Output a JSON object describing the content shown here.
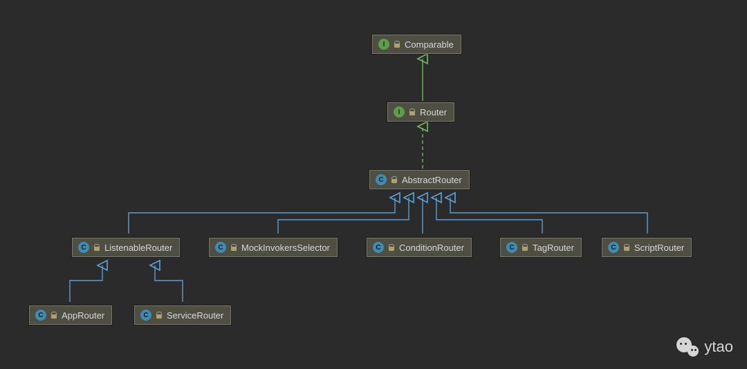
{
  "nodes": {
    "comparable": {
      "label": "Comparable",
      "type": "interface"
    },
    "router": {
      "label": "Router",
      "type": "interface"
    },
    "abstract": {
      "label": "AbstractRouter",
      "type": "class"
    },
    "listenable": {
      "label": "ListenableRouter",
      "type": "class"
    },
    "mock": {
      "label": "MockInvokersSelector",
      "type": "class"
    },
    "condition": {
      "label": "ConditionRouter",
      "type": "class"
    },
    "tag": {
      "label": "TagRouter",
      "type": "class"
    },
    "script": {
      "label": "ScriptRouter",
      "type": "class"
    },
    "app": {
      "label": "AppRouter",
      "type": "class"
    },
    "service": {
      "label": "ServiceRouter",
      "type": "class"
    }
  },
  "watermark": {
    "text": "ytao"
  },
  "colors": {
    "background": "#2b2b2b",
    "nodeFill": "#4e4e42",
    "nodeBorder": "#7a7a6a",
    "interfaceIcon": "#5d9c4c",
    "classIcon": "#3f8cb0",
    "implementsArrow": "#6fb85c",
    "extendsArrow": "#5a9fd4"
  },
  "edges": [
    {
      "from": "router",
      "to": "comparable",
      "kind": "extends-interface",
      "style": "solid",
      "color": "green"
    },
    {
      "from": "abstract",
      "to": "router",
      "kind": "implements",
      "style": "dashed",
      "color": "green"
    },
    {
      "from": "listenable",
      "to": "abstract",
      "kind": "extends",
      "style": "solid",
      "color": "blue"
    },
    {
      "from": "mock",
      "to": "abstract",
      "kind": "extends",
      "style": "solid",
      "color": "blue"
    },
    {
      "from": "condition",
      "to": "abstract",
      "kind": "extends",
      "style": "solid",
      "color": "blue"
    },
    {
      "from": "tag",
      "to": "abstract",
      "kind": "extends",
      "style": "solid",
      "color": "blue"
    },
    {
      "from": "script",
      "to": "abstract",
      "kind": "extends",
      "style": "solid",
      "color": "blue"
    },
    {
      "from": "app",
      "to": "listenable",
      "kind": "extends",
      "style": "solid",
      "color": "blue"
    },
    {
      "from": "service",
      "to": "listenable",
      "kind": "extends",
      "style": "solid",
      "color": "blue"
    }
  ]
}
